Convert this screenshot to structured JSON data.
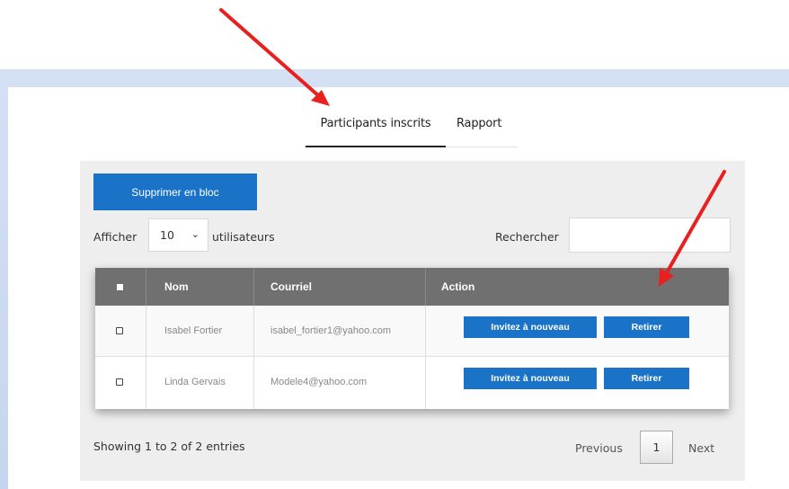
{
  "tabs": {
    "participants": "Participants inscrits",
    "rapport": "Rapport"
  },
  "toolbar": {
    "bulk_delete": "Supprimer en bloc"
  },
  "length": {
    "prefix": "Afficher",
    "value": "10",
    "suffix": "utilisateurs"
  },
  "search": {
    "label": "Rechercher",
    "value": ""
  },
  "table": {
    "headers": {
      "select": "■",
      "name": "Nom",
      "email": "Courriel",
      "action": "Action"
    },
    "rows": [
      {
        "name": "Isabel Fortier",
        "email": "isabel_fortier1@yahoo.com",
        "invite": "Invitez à nouveau",
        "remove": "Retirer"
      },
      {
        "name": "Linda Gervais",
        "email": "Modele4@yahoo.com",
        "invite": "Invitez à nouveau",
        "remove": "Retirer"
      }
    ]
  },
  "footer": {
    "info": "Showing 1 to 2 of 2 entries",
    "previous": "Previous",
    "page": "1",
    "next": "Next"
  },
  "icons": {
    "select_chevron": "chevron-down-icon",
    "annotation": "red-arrow"
  },
  "colors": {
    "primary": "#1a73c7",
    "header": "#707070",
    "panel": "#eeeeee",
    "frame": "#c6d5ee",
    "annotation": "#e8201f"
  }
}
